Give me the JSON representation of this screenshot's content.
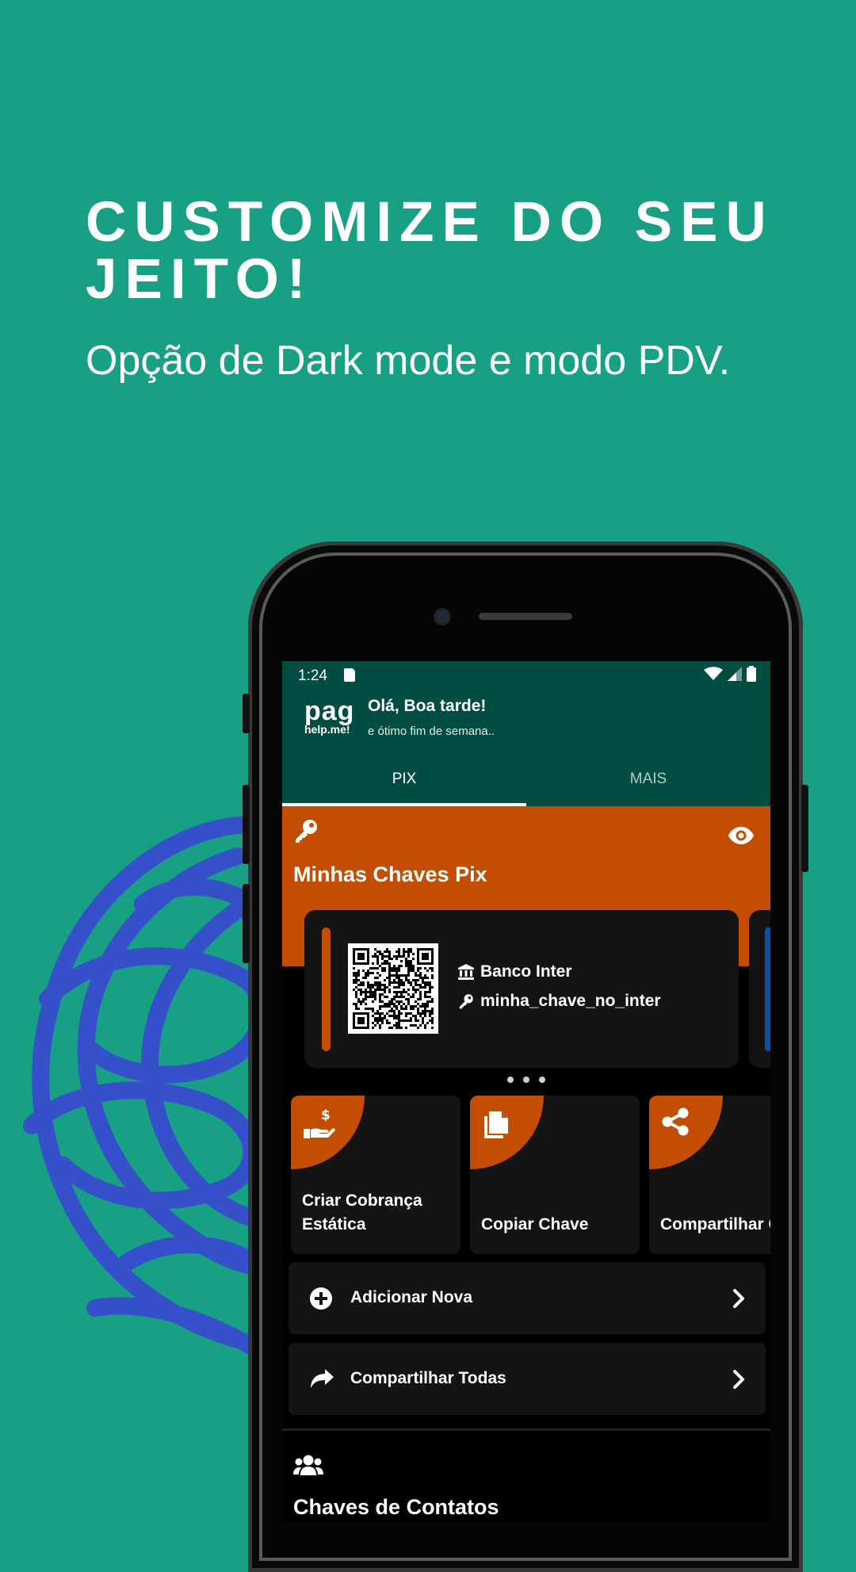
{
  "promo": {
    "headline": "CUSTOMIZE DO SEU JEITO!",
    "subline": "Opção de Dark mode e modo PDV."
  },
  "status_bar": {
    "time": "1:24"
  },
  "header": {
    "logo_main": "pag",
    "logo_sub": "help.me!",
    "greeting": "Olá, Boa tarde!",
    "subtitle": "e ótimo fim de semana.."
  },
  "tabs": [
    {
      "label": "PIX",
      "active": true
    },
    {
      "label": "MAIS",
      "active": false
    }
  ],
  "my_keys": {
    "title": "Minhas Chaves Pix",
    "card": {
      "bank": "Banco Inter",
      "key": "minha_chave_no_inter"
    }
  },
  "actions": [
    {
      "label": "Criar Cobrança Estática",
      "icon": "hand-dollar-icon"
    },
    {
      "label": "Copiar Chave",
      "icon": "copy-icon"
    },
    {
      "label": "Compartilhar Chave",
      "icon": "share-icon"
    }
  ],
  "list": {
    "add_new": "Adicionar Nova",
    "share_all": "Compartilhar Todas"
  },
  "contacts": {
    "title": "Chaves de Contatos"
  },
  "colors": {
    "background": "#17a084",
    "header": "#024d41",
    "accent": "#c34d00",
    "card": "#141414",
    "secondary_card_accent": "#0d4ea6",
    "scribble": "#3650cc"
  }
}
